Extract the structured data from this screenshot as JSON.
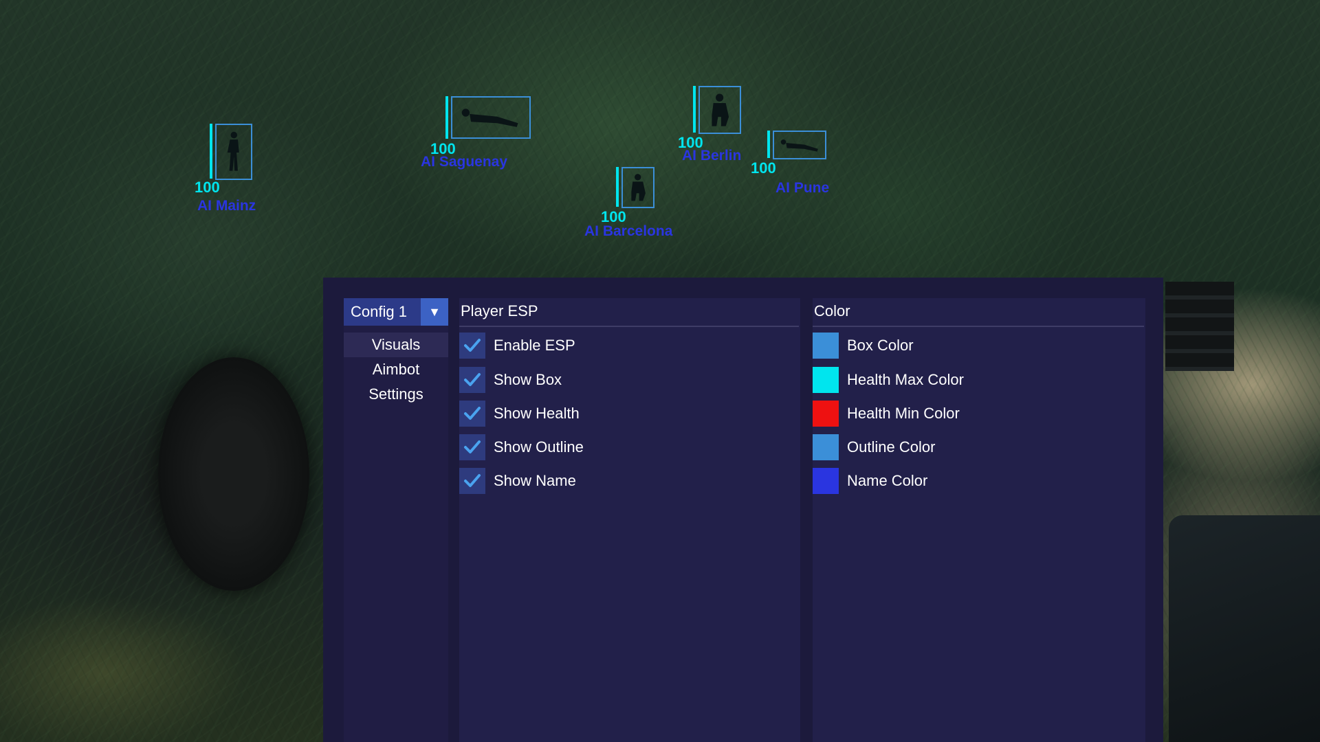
{
  "esp_targets": [
    {
      "health": "100",
      "name": "AI Mainz"
    },
    {
      "health": "100",
      "name": "AI Saguenay"
    },
    {
      "health": "100",
      "name": "AI Berlin"
    },
    {
      "health": "100",
      "name": "AI Barcelona"
    },
    {
      "health": "100",
      "name": "AI Pune"
    }
  ],
  "menu": {
    "config": {
      "selected": "Config 1",
      "arrow_icon": "triangle-down-icon"
    },
    "nav": [
      {
        "label": "Visuals",
        "active": true
      },
      {
        "label": "Aimbot",
        "active": false
      },
      {
        "label": "Settings",
        "active": false
      }
    ],
    "player_esp": {
      "title": "Player ESP",
      "options": [
        {
          "label": "Enable ESP",
          "checked": true
        },
        {
          "label": "Show Box",
          "checked": true
        },
        {
          "label": "Show Health",
          "checked": true
        },
        {
          "label": "Show Outline",
          "checked": true
        },
        {
          "label": "Show Name",
          "checked": true
        }
      ]
    },
    "color": {
      "title": "Color",
      "options": [
        {
          "label": "Box Color",
          "color": "#3b8fd8"
        },
        {
          "label": "Health Max Color",
          "color": "#00e5ee"
        },
        {
          "label": "Health Min Color",
          "color": "#ee1111"
        },
        {
          "label": "Outline Color",
          "color": "#3b8fd8"
        },
        {
          "label": "Name Color",
          "color": "#2a35e0"
        }
      ]
    }
  }
}
